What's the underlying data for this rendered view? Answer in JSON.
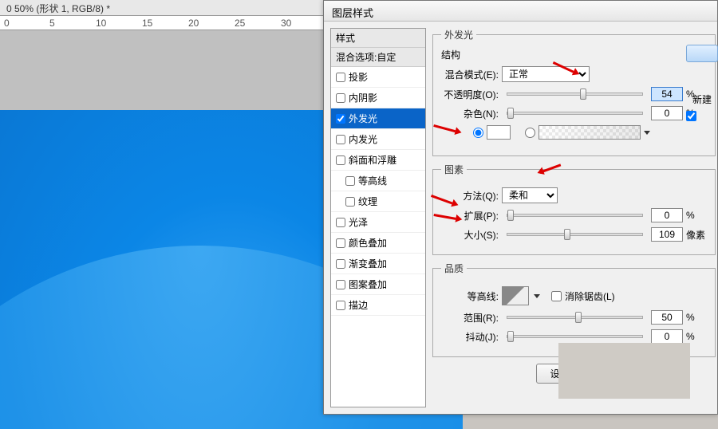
{
  "titlebar": "0 50% (形状 1, RGB/8) *",
  "ruler_marks": [
    "0",
    "5",
    "10",
    "15",
    "20",
    "25",
    "30"
  ],
  "dialog": {
    "title": "图层样式",
    "styles_header": "样式",
    "blend_options": "混合选项:自定",
    "items": [
      {
        "label": "投影",
        "checked": false
      },
      {
        "label": "内阴影",
        "checked": false
      },
      {
        "label": "外发光",
        "checked": true,
        "selected": true
      },
      {
        "label": "内发光",
        "checked": false
      },
      {
        "label": "斜面和浮雕",
        "checked": false
      },
      {
        "label": "等高线",
        "checked": false,
        "sub": true
      },
      {
        "label": "纹理",
        "checked": false,
        "sub": true
      },
      {
        "label": "光泽",
        "checked": false
      },
      {
        "label": "颜色叠加",
        "checked": false
      },
      {
        "label": "渐变叠加",
        "checked": false
      },
      {
        "label": "图案叠加",
        "checked": false
      },
      {
        "label": "描边",
        "checked": false
      }
    ],
    "outer_glow": {
      "legend_main": "外发光",
      "legend_struct": "结构",
      "blend_label": "混合模式(E):",
      "blend_value": "正常",
      "opacity_label": "不透明度(O):",
      "opacity_value": "54",
      "noise_label": "杂色(N):",
      "noise_value": "0",
      "pct": "%",
      "legend_elem": "图素",
      "method_label": "方法(Q):",
      "method_value": "柔和",
      "spread_label": "扩展(P):",
      "spread_value": "0",
      "size_label": "大小(S):",
      "size_value": "109",
      "px": "像素",
      "legend_quality": "品质",
      "contour_label": "等高线:",
      "antialias": "消除锯齿(L)",
      "range_label": "范围(R):",
      "range_value": "50",
      "jitter_label": "抖动(J):",
      "jitter_value": "0",
      "default_btn": "设置为默认"
    },
    "new_btn": "新建"
  }
}
